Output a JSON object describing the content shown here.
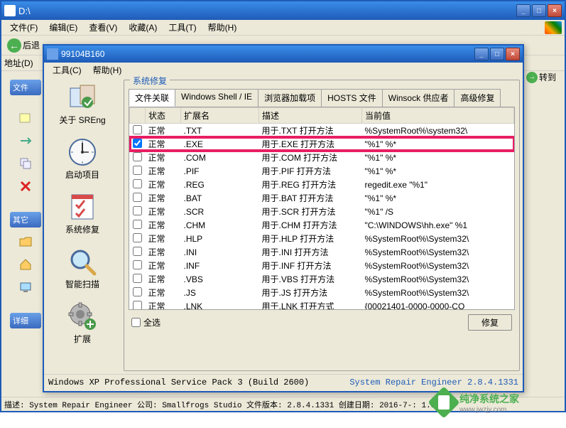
{
  "outer_window": {
    "title": "D:\\",
    "menu": [
      "文件(F)",
      "编辑(E)",
      "查看(V)",
      "收藏(A)",
      "工具(T)",
      "帮助(H)"
    ],
    "back_label": "后退",
    "addr_label": "地址(D)",
    "goto_label": "转到",
    "status": "描述: System Repair Engineer 公司: Smallfrogs Studio 文件版本: 2.8.4.1331 创建日期: 2016-7-: 1.80 MB"
  },
  "bg_sidebar": {
    "tab1": "文件",
    "tab2": "其它",
    "tab3": "详细"
  },
  "inner_window": {
    "title": "99104B160",
    "menu": [
      "工具(C)",
      "帮助(H)"
    ],
    "status_left": "Windows XP Professional Service Pack 3 (Build 2600)",
    "status_right": "System Repair Engineer 2.8.4.1331"
  },
  "sidebar": {
    "items": [
      {
        "label": "关于 SREng"
      },
      {
        "label": "启动项目"
      },
      {
        "label": "系统修复"
      },
      {
        "label": "智能扫描"
      },
      {
        "label": "扩展"
      }
    ]
  },
  "groupbox_title": "系统修复",
  "tabs": [
    "文件关联",
    "Windows Shell / IE",
    "浏览器加载项",
    "HOSTS 文件",
    "Winsock 供应者",
    "高级修复"
  ],
  "active_tab": 0,
  "table": {
    "headers": [
      "状态",
      "扩展名",
      "描述",
      "当前值"
    ],
    "rows": [
      {
        "checked": false,
        "status": "正常",
        "ext": ".TXT",
        "desc": "用于.TXT 打开方法",
        "value": "%SystemRoot%\\system32\\"
      },
      {
        "checked": true,
        "status": "正常",
        "ext": ".EXE",
        "desc": "用于.EXE 打开方法",
        "value": "\"%1\" %*",
        "highlight": true
      },
      {
        "checked": false,
        "status": "正常",
        "ext": ".COM",
        "desc": "用于.COM 打开方法",
        "value": "\"%1\" %*"
      },
      {
        "checked": false,
        "status": "正常",
        "ext": ".PIF",
        "desc": "用于.PIF 打开方法",
        "value": "\"%1\" %*"
      },
      {
        "checked": false,
        "status": "正常",
        "ext": ".REG",
        "desc": "用于.REG 打开方法",
        "value": "regedit.exe \"%1\""
      },
      {
        "checked": false,
        "status": "正常",
        "ext": ".BAT",
        "desc": "用于.BAT 打开方法",
        "value": "\"%1\" %*"
      },
      {
        "checked": false,
        "status": "正常",
        "ext": ".SCR",
        "desc": "用于.SCR 打开方法",
        "value": "\"%1\" /S"
      },
      {
        "checked": false,
        "status": "正常",
        "ext": ".CHM",
        "desc": "用于.CHM 打开方法",
        "value": "\"C:\\WINDOWS\\hh.exe\" %1"
      },
      {
        "checked": false,
        "status": "正常",
        "ext": ".HLP",
        "desc": "用于.HLP 打开方法",
        "value": "%SystemRoot%\\System32\\"
      },
      {
        "checked": false,
        "status": "正常",
        "ext": ".INI",
        "desc": "用于.INI 打开方法",
        "value": "%SystemRoot%\\System32\\"
      },
      {
        "checked": false,
        "status": "正常",
        "ext": ".INF",
        "desc": "用于.INF 打开方法",
        "value": "%SystemRoot%\\System32\\"
      },
      {
        "checked": false,
        "status": "正常",
        "ext": ".VBS",
        "desc": "用于.VBS 打开方法",
        "value": "%SystemRoot%\\System32\\"
      },
      {
        "checked": false,
        "status": "正常",
        "ext": ".JS",
        "desc": "用于.JS 打开方法",
        "value": "%SystemRoot%\\System32\\"
      },
      {
        "checked": false,
        "status": "正常",
        "ext": ".LNK",
        "desc": "用于.LNK 打开方式",
        "value": "{00021401-0000-0000-CO"
      }
    ]
  },
  "select_all": "全选",
  "repair_btn": "修复",
  "watermark": {
    "text": "纯净系统之家",
    "sub": "www.jwzjy.com"
  }
}
